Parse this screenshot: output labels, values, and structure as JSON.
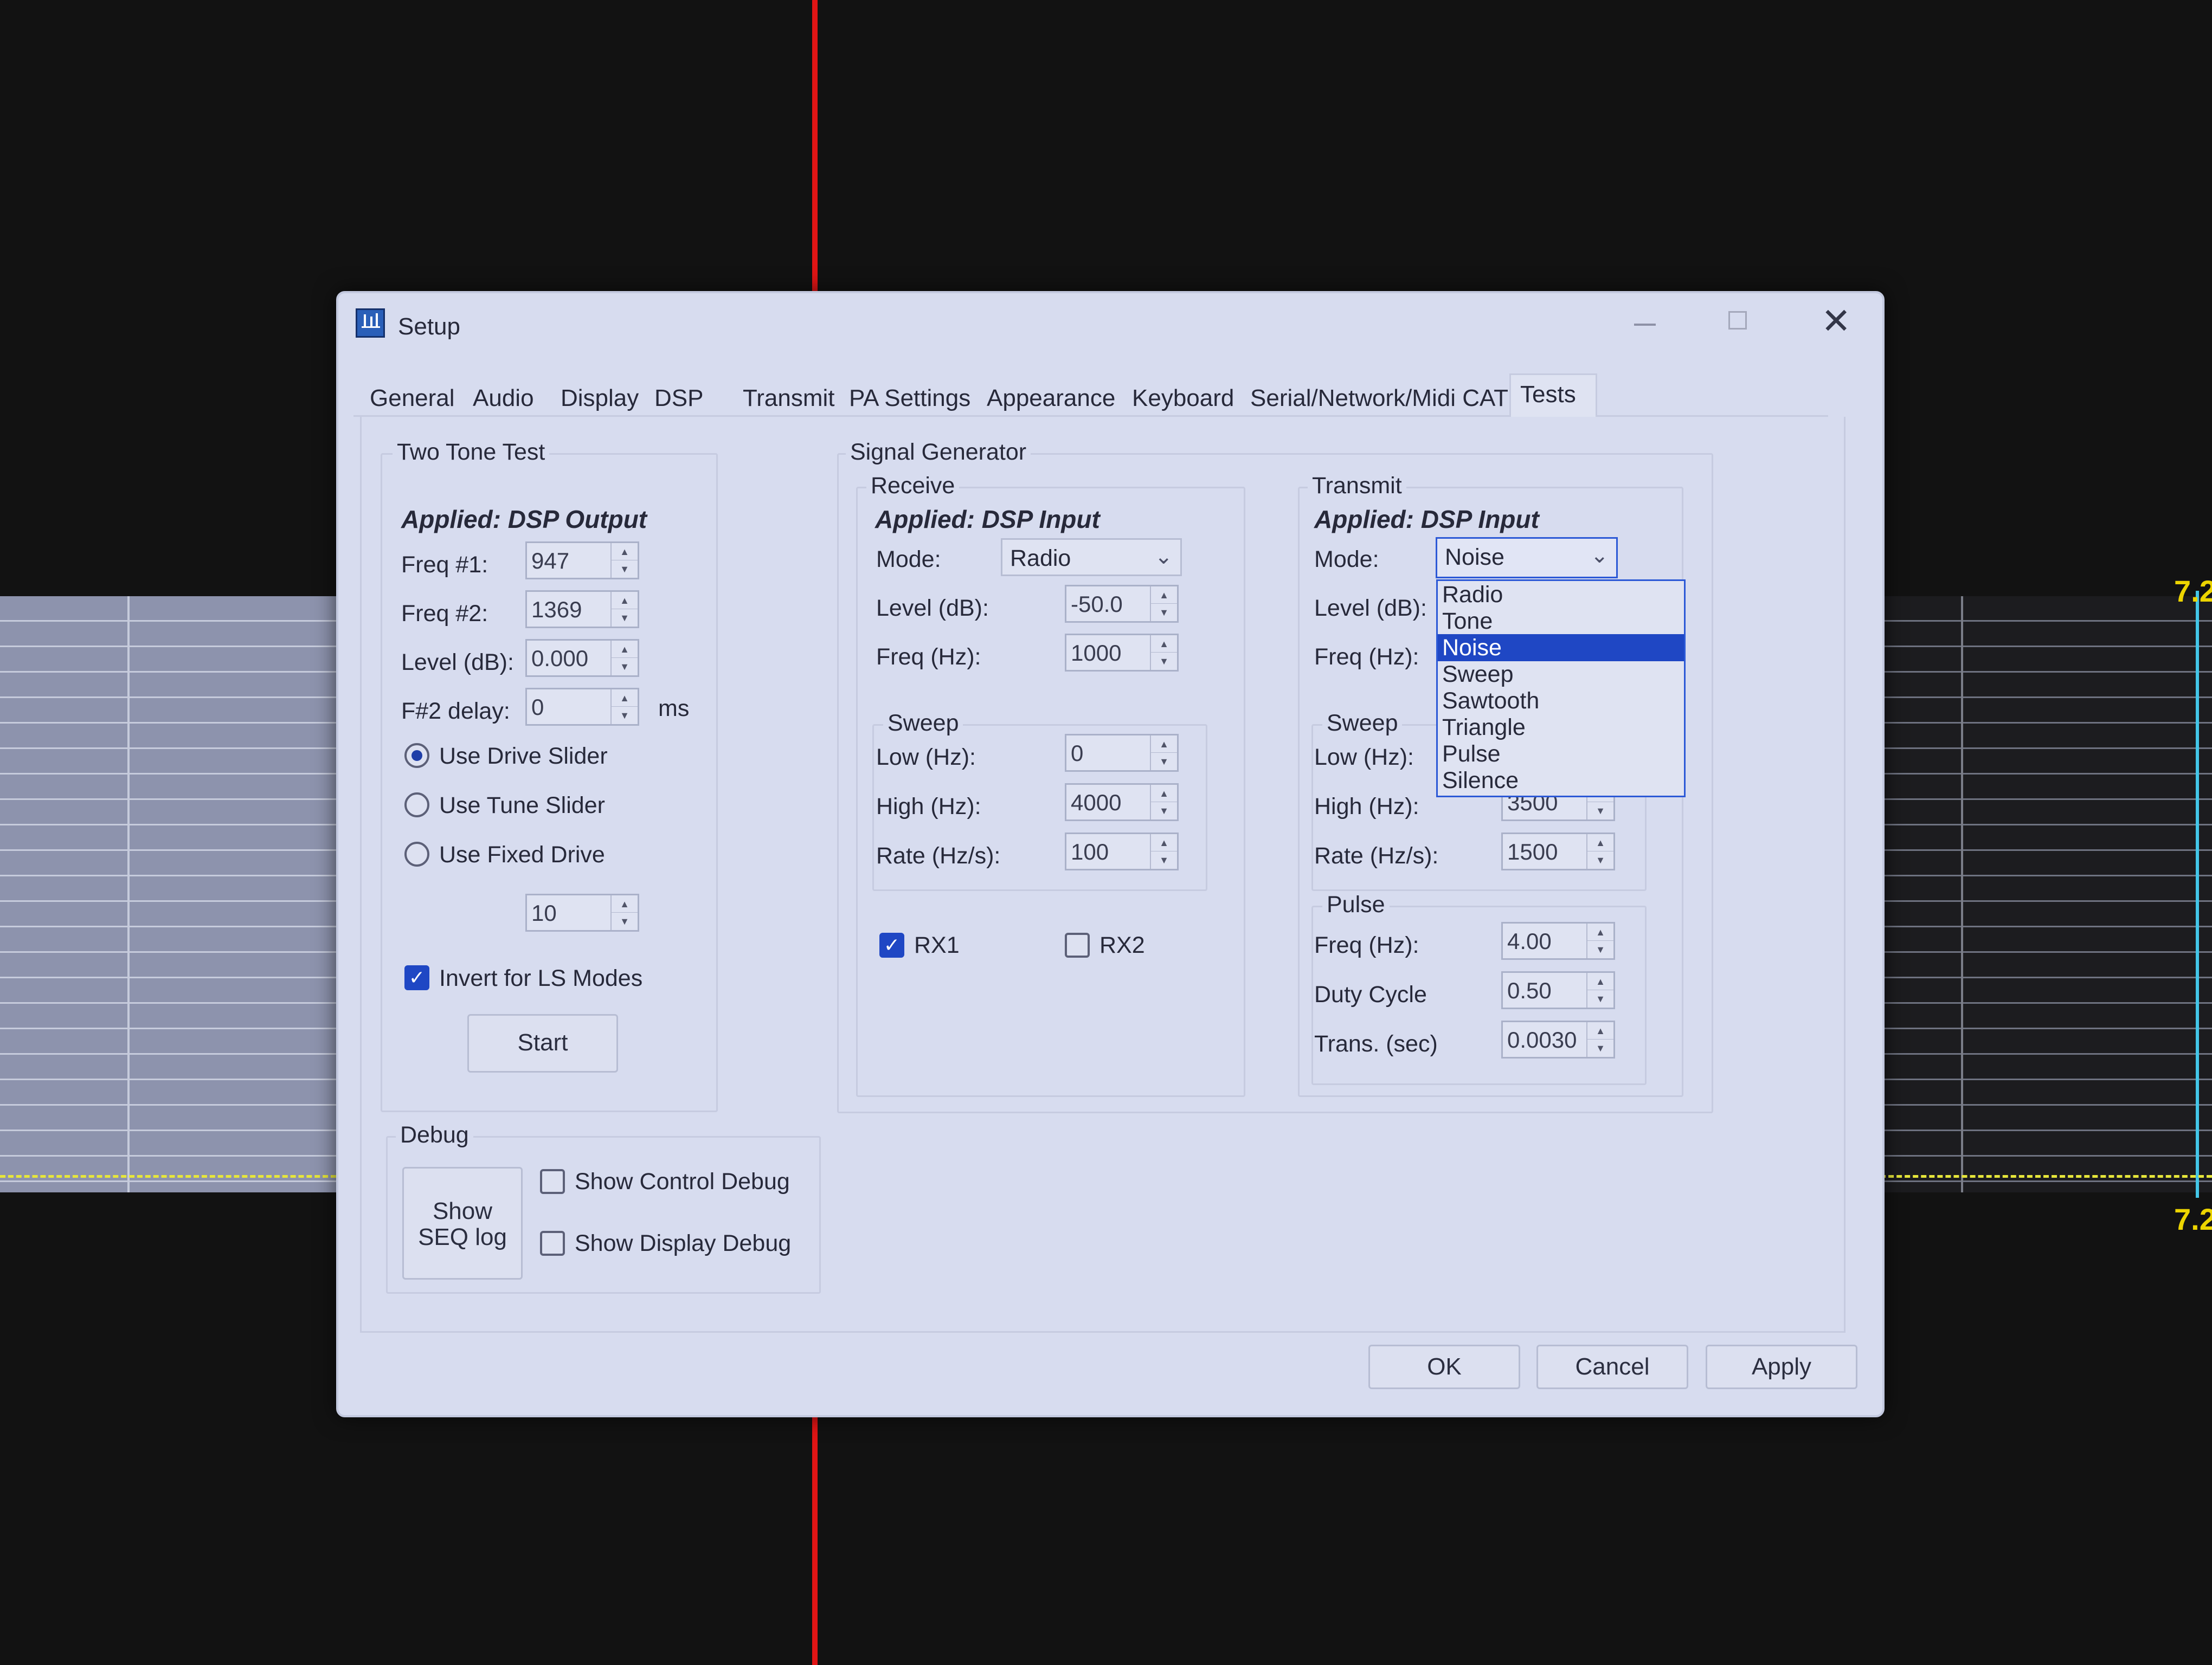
{
  "window": {
    "title": "Setup"
  },
  "tabs": [
    "General",
    "Audio",
    "Display",
    "DSP",
    "Transmit",
    "PA Settings",
    "Appearance",
    "Keyboard",
    "Serial/Network/Midi CAT",
    "Tests"
  ],
  "active_tab": "Tests",
  "two_tone": {
    "group_label": "Two Tone Test",
    "applied": "Applied: DSP Output",
    "freq1_label": "Freq #1:",
    "freq1_value": "947",
    "freq2_label": "Freq #2:",
    "freq2_value": "1369",
    "level_label": "Level (dB):",
    "level_value": "0.000",
    "delay_label": "F#2 delay:",
    "delay_value": "0",
    "delay_unit": "ms",
    "radio_drive": "Use Drive Slider",
    "radio_tune": "Use Tune Slider",
    "radio_fixed": "Use Fixed Drive",
    "selected_radio": "Use Drive Slider",
    "fixed_drive_value": "10",
    "invert_label": "Invert for LS Modes",
    "invert_checked": true,
    "start_label": "Start"
  },
  "signal_generator": {
    "group_label": "Signal Generator",
    "receive": {
      "label": "Receive",
      "applied": "Applied: DSP Input",
      "mode_label": "Mode:",
      "mode_value": "Radio",
      "level_label": "Level (dB):",
      "level_value": "-50.0",
      "freq_label": "Freq (Hz):",
      "freq_value": "1000",
      "sweep_label": "Sweep",
      "low_label": "Low (Hz):",
      "low_value": "0",
      "high_label": "High (Hz):",
      "high_value": "4000",
      "rate_label": "Rate (Hz/s):",
      "rate_value": "100",
      "rx1_label": "RX1",
      "rx1_checked": true,
      "rx2_label": "RX2",
      "rx2_checked": false
    },
    "transmit": {
      "label": "Transmit",
      "applied": "Applied: DSP Input",
      "mode_label": "Mode:",
      "mode_value": "Noise",
      "mode_options": [
        "Radio",
        "Tone",
        "Noise",
        "Sweep",
        "Sawtooth",
        "Triangle",
        "Pulse",
        "Silence"
      ],
      "level_label": "Level (dB):",
      "freq_label": "Freq (Hz):",
      "sweep_label": "Sweep",
      "low_label": "Low (Hz):",
      "high_label": "High (Hz):",
      "high_value": "3500",
      "rate_label": "Rate (Hz/s):",
      "rate_value": "1500",
      "pulse_label": "Pulse",
      "pulse_freq_label": "Freq (Hz):",
      "pulse_freq_value": "4.00",
      "duty_label": "Duty Cycle",
      "duty_value": "0.50",
      "trans_label": "Trans. (sec)",
      "trans_value": "0.0030"
    }
  },
  "debug": {
    "group_label": "Debug",
    "seq_button_line1": "Show",
    "seq_button_line2": "SEQ log",
    "control_debug_label": "Show Control Debug",
    "display_debug_label": "Show Display Debug"
  },
  "footer": {
    "ok": "OK",
    "cancel": "Cancel",
    "apply": "Apply"
  },
  "background": {
    "scale_label_top": "7.2",
    "scale_label_bottom": "7.2"
  },
  "colors": {
    "marker_red": "#e01515",
    "dashed_yellow": "#e6e63a",
    "scale_label_yellow": "#ecd400",
    "selection_blue": "#1f47c4"
  }
}
